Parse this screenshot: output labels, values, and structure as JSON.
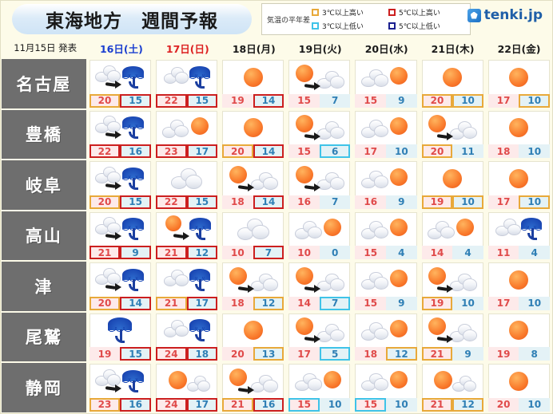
{
  "header": {
    "title": "東海地方　週間予報",
    "legend_label": "気温の平年差",
    "legend_items": [
      {
        "text": "3℃以上高い",
        "color": "#e8a93a"
      },
      {
        "text": "5℃以上高い",
        "color": "#cc1f1f"
      },
      {
        "text": "3℃以上低い",
        "color": "#3fc3e8"
      },
      {
        "text": "5℃以上低い",
        "color": "#1a1f8f"
      }
    ],
    "brand": "tenki.jp",
    "brand_icon": "tenki-cube-icon"
  },
  "issue_date": "11月15日 発表",
  "days": [
    {
      "label": "16日(土)",
      "color": "#1b3fd0"
    },
    {
      "label": "17日(日)",
      "color": "#dd2222"
    },
    {
      "label": "18日(月)",
      "color": "#1a1a1a"
    },
    {
      "label": "19日(火)",
      "color": "#1a1a1a"
    },
    {
      "label": "20日(水)",
      "color": "#1a1a1a"
    },
    {
      "label": "21日(木)",
      "color": "#1a1a1a"
    },
    {
      "label": "22日(金)",
      "color": "#1a1a1a"
    }
  ],
  "rows": [
    {
      "city": "名古屋",
      "cells": [
        {
          "icon": "cloud-then-rain",
          "high": "20",
          "low": "15",
          "high_box": "orange",
          "low_box": "red"
        },
        {
          "icon": "cloud-and-rain",
          "high": "22",
          "low": "15",
          "high_box": "red",
          "low_box": "red"
        },
        {
          "icon": "sunny",
          "high": "19",
          "low": "14",
          "high_box": "none",
          "low_box": "red"
        },
        {
          "icon": "sun-then-cloud",
          "high": "15",
          "low": "7",
          "high_box": "none",
          "low_box": "none"
        },
        {
          "icon": "cloud-then-sun",
          "high": "15",
          "low": "9",
          "high_box": "none",
          "low_box": "none"
        },
        {
          "icon": "sunny",
          "high": "20",
          "low": "10",
          "high_box": "orange",
          "low_box": "orange"
        },
        {
          "icon": "sunny",
          "high": "17",
          "low": "10",
          "high_box": "none",
          "low_box": "orange"
        }
      ]
    },
    {
      "city": "豊橋",
      "cells": [
        {
          "icon": "cloud-then-rain",
          "high": "22",
          "low": "16",
          "high_box": "red",
          "low_box": "red"
        },
        {
          "icon": "cloud-then-sun",
          "high": "23",
          "low": "17",
          "high_box": "red",
          "low_box": "red"
        },
        {
          "icon": "sunny",
          "high": "20",
          "low": "14",
          "high_box": "orange",
          "low_box": "red"
        },
        {
          "icon": "sun-then-cloud",
          "high": "15",
          "low": "6",
          "high_box": "none",
          "low_box": "cyan"
        },
        {
          "icon": "cloud-then-sun",
          "high": "17",
          "low": "10",
          "high_box": "none",
          "low_box": "none"
        },
        {
          "icon": "sun-then-cloud",
          "high": "20",
          "low": "11",
          "high_box": "orange",
          "low_box": "none"
        },
        {
          "icon": "sunny",
          "high": "18",
          "low": "10",
          "high_box": "none",
          "low_box": "none"
        }
      ]
    },
    {
      "city": "岐阜",
      "cells": [
        {
          "icon": "cloud-then-rain",
          "high": "20",
          "low": "15",
          "high_box": "orange",
          "low_box": "red"
        },
        {
          "icon": "cloudy",
          "high": "22",
          "low": "15",
          "high_box": "red",
          "low_box": "red"
        },
        {
          "icon": "sun-then-cloud",
          "high": "18",
          "low": "14",
          "high_box": "none",
          "low_box": "red"
        },
        {
          "icon": "sun-then-cloud",
          "high": "16",
          "low": "7",
          "high_box": "none",
          "low_box": "none"
        },
        {
          "icon": "cloud-then-sun",
          "high": "16",
          "low": "9",
          "high_box": "none",
          "low_box": "none"
        },
        {
          "icon": "sunny",
          "high": "19",
          "low": "10",
          "high_box": "orange",
          "low_box": "orange"
        },
        {
          "icon": "sunny",
          "high": "17",
          "low": "10",
          "high_box": "none",
          "low_box": "orange"
        }
      ]
    },
    {
      "city": "高山",
      "cells": [
        {
          "icon": "cloud-then-rain",
          "high": "21",
          "low": "9",
          "high_box": "red",
          "low_box": "red"
        },
        {
          "icon": "sun-then-rain",
          "high": "21",
          "low": "12",
          "high_box": "red",
          "low_box": "red"
        },
        {
          "icon": "cloudy",
          "high": "10",
          "low": "7",
          "high_box": "none",
          "low_box": "red"
        },
        {
          "icon": "cloud-then-sun",
          "high": "10",
          "low": "0",
          "high_box": "none",
          "low_box": "none"
        },
        {
          "icon": "cloud-then-sun",
          "high": "15",
          "low": "4",
          "high_box": "none",
          "low_box": "none"
        },
        {
          "icon": "cloud-then-sun",
          "high": "14",
          "low": "4",
          "high_box": "none",
          "low_box": "none"
        },
        {
          "icon": "cloud-and-rain",
          "high": "11",
          "low": "4",
          "high_box": "none",
          "low_box": "none"
        }
      ]
    },
    {
      "city": "津",
      "cells": [
        {
          "icon": "cloud-then-rain",
          "high": "20",
          "low": "14",
          "high_box": "orange",
          "low_box": "red"
        },
        {
          "icon": "cloud-and-rain",
          "high": "21",
          "low": "17",
          "high_box": "orange",
          "low_box": "red"
        },
        {
          "icon": "sun-then-cloud",
          "high": "18",
          "low": "12",
          "high_box": "none",
          "low_box": "orange"
        },
        {
          "icon": "sun-then-cloud",
          "high": "14",
          "low": "7",
          "high_box": "none",
          "low_box": "cyan"
        },
        {
          "icon": "cloud-then-sun",
          "high": "15",
          "low": "9",
          "high_box": "none",
          "low_box": "none"
        },
        {
          "icon": "sun-then-cloud",
          "high": "19",
          "low": "10",
          "high_box": "orange",
          "low_box": "none"
        },
        {
          "icon": "sunny",
          "high": "17",
          "low": "10",
          "high_box": "none",
          "low_box": "none"
        }
      ]
    },
    {
      "city": "尾鷲",
      "cells": [
        {
          "icon": "rain",
          "high": "19",
          "low": "15",
          "high_box": "none",
          "low_box": "red"
        },
        {
          "icon": "cloud-and-rain",
          "high": "24",
          "low": "18",
          "high_box": "red",
          "low_box": "red"
        },
        {
          "icon": "sunny",
          "high": "20",
          "low": "13",
          "high_box": "none",
          "low_box": "orange"
        },
        {
          "icon": "sun-then-cloud",
          "high": "17",
          "low": "5",
          "high_box": "none",
          "low_box": "cyan"
        },
        {
          "icon": "cloud-then-sun",
          "high": "18",
          "low": "12",
          "high_box": "none",
          "low_box": "orange"
        },
        {
          "icon": "sun-then-cloud",
          "high": "21",
          "low": "9",
          "high_box": "orange",
          "low_box": "none"
        },
        {
          "icon": "sunny",
          "high": "19",
          "low": "8",
          "high_box": "none",
          "low_box": "none"
        }
      ]
    },
    {
      "city": "静岡",
      "cells": [
        {
          "icon": "cloud-then-rain",
          "high": "23",
          "low": "16",
          "high_box": "orange",
          "low_box": "red"
        },
        {
          "icon": "sun-and-cloud",
          "high": "24",
          "low": "17",
          "high_box": "red",
          "low_box": "red"
        },
        {
          "icon": "sun-then-cloud",
          "high": "21",
          "low": "16",
          "high_box": "orange",
          "low_box": "red"
        },
        {
          "icon": "cloud-then-sun",
          "high": "15",
          "low": "10",
          "high_box": "cyan",
          "low_box": "none"
        },
        {
          "icon": "cloud-then-sun",
          "high": "15",
          "low": "10",
          "high_box": "cyan",
          "low_box": "none"
        },
        {
          "icon": "sun-and-cloud",
          "high": "21",
          "low": "12",
          "high_box": "orange",
          "low_box": "orange"
        },
        {
          "icon": "sunny",
          "high": "20",
          "low": "10",
          "high_box": "none",
          "low_box": "none"
        }
      ]
    }
  ]
}
